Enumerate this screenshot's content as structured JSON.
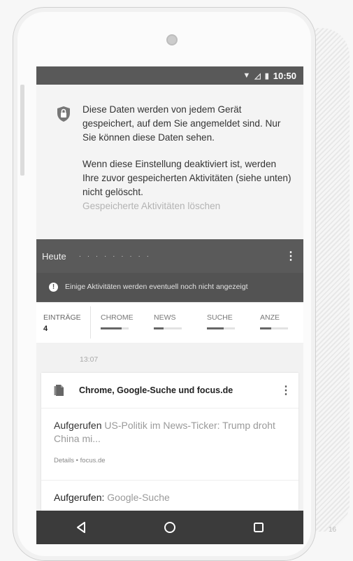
{
  "status_bar": {
    "time": "10:50",
    "icons": [
      "wifi-icon",
      "signal-icon",
      "battery-icon"
    ]
  },
  "info": {
    "paragraph_1": "Diese Daten werden von jedem Gerät gespeichert, auf dem Sie angemeldet sind. Nur Sie können diese Daten sehen.",
    "paragraph_2": "Wenn diese Einstellung deaktiviert ist, werden Ihre zuvor gespeicherten Aktivitäten (siehe unten) nicht gelöscht.",
    "delete_link": "Gespeicherte Aktivitäten löschen"
  },
  "activity_header": {
    "today_label": "Heute",
    "notice": "Einige Aktivitäten werden eventuell noch nicht angezeigt"
  },
  "tabs": {
    "count_label": "EINTRÄGE",
    "count_value": "4",
    "items": [
      {
        "label": "CHROME",
        "fill": 0.75
      },
      {
        "label": "NEWS",
        "fill": 0.35
      },
      {
        "label": "SUCHE",
        "fill": 0.6
      },
      {
        "label": "ANZE",
        "fill": 0.4
      }
    ]
  },
  "timeline": {
    "time": "13:07",
    "card_title": "Chrome, Google-Suche und focus.de",
    "entry_1": {
      "prefix": "Aufgerufen",
      "title": "US-Politik im News-Ticker: Trump droht China mi...",
      "meta": "Details • focus.de"
    },
    "entry_2": {
      "prefix": "Aufgerufen:",
      "title": "Google-Suche"
    }
  },
  "page_number": "16",
  "colors": {
    "status_bar": "#595959",
    "dark_card": "#5a5a5a",
    "navbar": "#3b3b3b"
  }
}
